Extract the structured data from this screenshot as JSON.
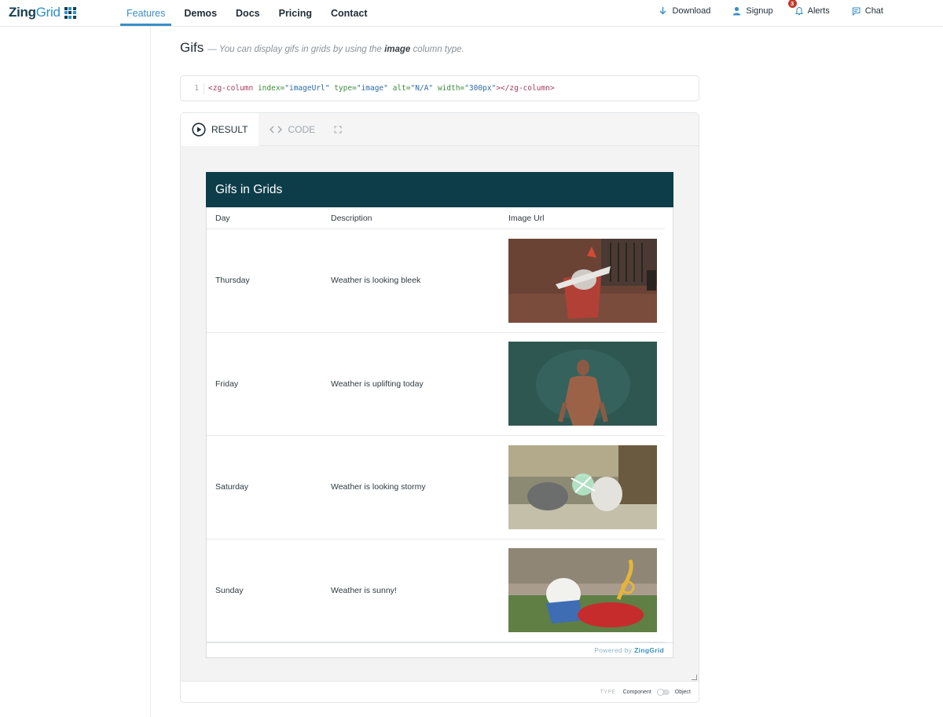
{
  "nav": {
    "logo_zing": "Zing",
    "logo_grid": "Grid",
    "links": [
      {
        "label": "Features",
        "active": true
      },
      {
        "label": "Demos"
      },
      {
        "label": "Docs"
      },
      {
        "label": "Pricing"
      },
      {
        "label": "Contact"
      }
    ],
    "actions": {
      "download": "Download",
      "signup": "Signup",
      "alerts": "Alerts",
      "alerts_count": "3",
      "chat": "Chat"
    }
  },
  "section": {
    "title": "Gifs",
    "sub_prefix": "— You can display gifs in grids by using the",
    "sub_emph": "image",
    "sub_suffix": "column type."
  },
  "code": {
    "line_number": "1",
    "tag_open": "<zg-column",
    "attr1": "index=",
    "val1": "\"imageUrl\"",
    "attr2": "type=",
    "val2": "\"image\"",
    "attr3": "alt=",
    "val3": "\"N/A\"",
    "attr4": "width=",
    "val4": "\"300px\"",
    "tag_close": "></zg-column>"
  },
  "demo": {
    "tabs": {
      "result": "RESULT",
      "code": "CODE"
    },
    "grid": {
      "caption": "Gifs in Grids",
      "headers": {
        "day": "Day",
        "description": "Description",
        "image": "Image Url"
      },
      "rows": [
        {
          "day": "Thursday",
          "description": "Weather is looking bleek",
          "image": "cat-in-box-gif"
        },
        {
          "day": "Friday",
          "description": "Weather is uplifting today",
          "image": "bodybuilder-gif"
        },
        {
          "day": "Saturday",
          "description": "Weather is looking stormy",
          "image": "cats-lightning-gif"
        },
        {
          "day": "Sunday",
          "description": "Weather is sunny!",
          "image": "cat-toy-car-gif"
        }
      ],
      "powered_by": "Powered by",
      "powered_brand": "ZingGrid"
    },
    "footer": {
      "type": "TYPE",
      "component": "Component",
      "object": "Object"
    }
  },
  "colors": {
    "brand_dark": "#0e3d4a",
    "accent": "#3a8fc4",
    "alert_badge": "#c0392b"
  }
}
